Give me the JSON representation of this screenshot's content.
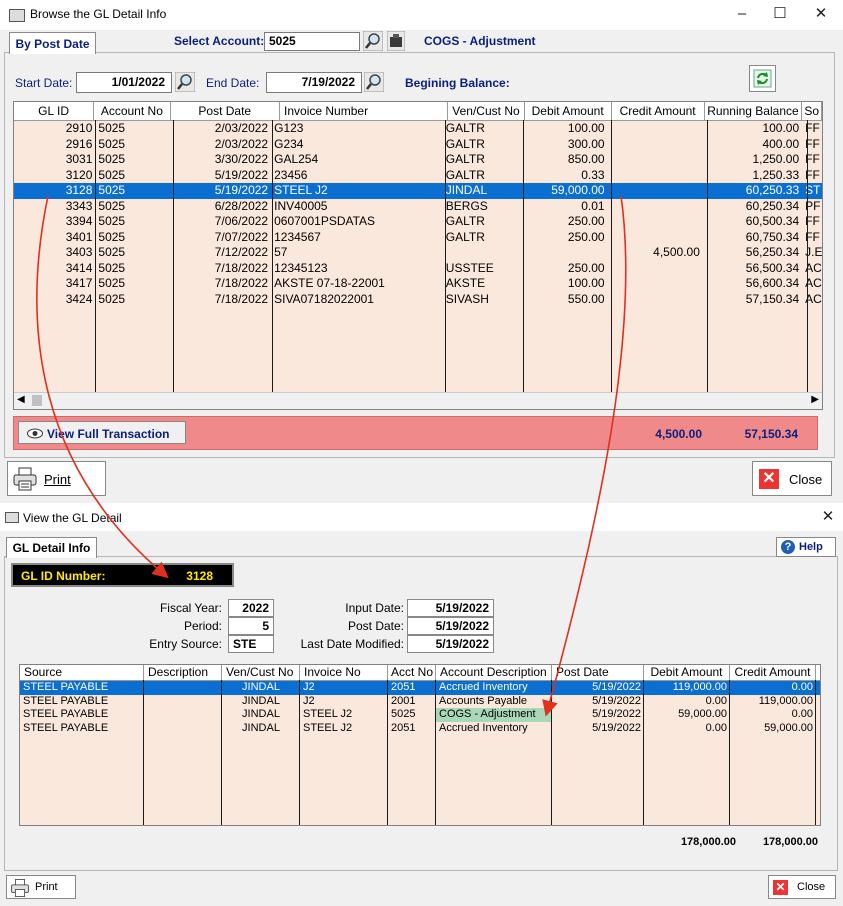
{
  "win1": {
    "title": "Browse the GL Detail Info",
    "tab": "By Post Date",
    "select_account_label": "Select Account:",
    "account_value": "5025",
    "account_name": "COGS - Adjustment",
    "start_date_label": "Start Date:",
    "start_date": "1/01/2022",
    "end_date_label": "End Date:",
    "end_date": "7/19/2022",
    "beginning_balance_label": "Begining Balance:",
    "columns": [
      "GL ID",
      "Account No",
      "Post Date",
      "Invoice Number",
      "Ven/Cust No",
      "Debit Amount",
      "Credit Amount",
      "Running Balance",
      "So"
    ],
    "rows": [
      {
        "id": "2910",
        "acct": "5025",
        "date": "2/03/2022",
        "inv": "G123",
        "ven": "GALTR",
        "debit": "100.00",
        "credit": "",
        "bal": "100.00",
        "src": "FF"
      },
      {
        "id": "2916",
        "acct": "5025",
        "date": "2/03/2022",
        "inv": "G234",
        "ven": "GALTR",
        "debit": "300.00",
        "credit": "",
        "bal": "400.00",
        "src": "FF"
      },
      {
        "id": "3031",
        "acct": "5025",
        "date": "3/30/2022",
        "inv": "GAL254",
        "ven": "GALTR",
        "debit": "850.00",
        "credit": "",
        "bal": "1,250.00",
        "src": "FF"
      },
      {
        "id": "3120",
        "acct": "5025",
        "date": "5/19/2022",
        "inv": "23456",
        "ven": "GALTR",
        "debit": "0.33",
        "credit": "",
        "bal": "1,250.33",
        "src": "FF"
      },
      {
        "id": "3128",
        "acct": "5025",
        "date": "5/19/2022",
        "inv": "STEEL J2",
        "ven": "JINDAL",
        "debit": "59,000.00",
        "credit": "",
        "bal": "60,250.33",
        "src": "ST"
      },
      {
        "id": "3343",
        "acct": "5025",
        "date": "6/28/2022",
        "inv": "INV40005",
        "ven": "BERGS",
        "debit": "0.01",
        "credit": "",
        "bal": "60,250.34",
        "src": "PF"
      },
      {
        "id": "3394",
        "acct": "5025",
        "date": "7/06/2022",
        "inv": "0607001PSDATAS",
        "ven": "GALTR",
        "debit": "250.00",
        "credit": "",
        "bal": "60,500.34",
        "src": "FF"
      },
      {
        "id": "3401",
        "acct": "5025",
        "date": "7/07/2022",
        "inv": "1234567",
        "ven": "GALTR",
        "debit": "250.00",
        "credit": "",
        "bal": "60,750.34",
        "src": "FF"
      },
      {
        "id": "3403",
        "acct": "5025",
        "date": "7/12/2022",
        "inv": "57",
        "ven": "",
        "debit": "",
        "credit": "4,500.00",
        "bal": "56,250.34",
        "src": "J.E"
      },
      {
        "id": "3414",
        "acct": "5025",
        "date": "7/18/2022",
        "inv": "12345123",
        "ven": "USSTEE",
        "debit": "250.00",
        "credit": "",
        "bal": "56,500.34",
        "src": "AC"
      },
      {
        "id": "3417",
        "acct": "5025",
        "date": "7/18/2022",
        "inv": "AKSTE 07-18-22001",
        "ven": "AKSTE",
        "debit": "100.00",
        "credit": "",
        "bal": "56,600.34",
        "src": "AC"
      },
      {
        "id": "3424",
        "acct": "5025",
        "date": "7/18/2022",
        "inv": "SIVA07182022001",
        "ven": "SIVASH",
        "debit": "550.00",
        "credit": "",
        "bal": "57,150.34",
        "src": "AC"
      }
    ],
    "view_full_label": "View Full Transaction",
    "total_credit": "4,500.00",
    "total_balance": "57,150.34",
    "print_label": "Print",
    "close_label": "Close"
  },
  "win2": {
    "title": "View the GL Detail",
    "tab": "GL Detail Info",
    "help_label": "Help",
    "gl_id_label": "GL ID Number:",
    "gl_id_value": "3128",
    "fiscal_year_label": "Fiscal Year:",
    "fiscal_year": "2022",
    "period_label": "Period:",
    "period": "5",
    "entry_source_label": "Entry Source:",
    "entry_source": "STE",
    "input_date_label": "Input Date:",
    "input_date": "5/19/2022",
    "post_date_label": "Post Date:",
    "post_date": "5/19/2022",
    "last_modified_label": "Last Date Modified:",
    "last_modified": "5/19/2022",
    "columns": [
      "Source",
      "Description",
      "Ven/Cust No",
      "Invoice No",
      "Acct No",
      "Account Description",
      "Post Date",
      "Debit Amount",
      "Credit Amount"
    ],
    "rows": [
      {
        "src": "STEEL PAYABLE",
        "desc": "",
        "ven": "JINDAL",
        "inv": "J2",
        "acct": "2051",
        "adesc": "Accrued Inventory",
        "date": "5/19/2022",
        "debit": "119,000.00",
        "credit": "0.00"
      },
      {
        "src": "STEEL PAYABLE",
        "desc": "",
        "ven": "JINDAL",
        "inv": "J2",
        "acct": "2001",
        "adesc": "Accounts Payable",
        "date": "5/19/2022",
        "debit": "0.00",
        "credit": "119,000.00"
      },
      {
        "src": "STEEL PAYABLE",
        "desc": "",
        "ven": "JINDAL",
        "inv": "STEEL J2",
        "acct": "5025",
        "adesc": "COGS - Adjustment",
        "date": "5/19/2022",
        "debit": "59,000.00",
        "credit": "0.00"
      },
      {
        "src": "STEEL PAYABLE",
        "desc": "",
        "ven": "JINDAL",
        "inv": "STEEL J2",
        "acct": "2051",
        "adesc": "Accrued Inventory",
        "date": "5/19/2022",
        "debit": "0.00",
        "credit": "59,000.00"
      }
    ],
    "total_debit": "178,000.00",
    "total_credit": "178,000.00",
    "print_label": "Print",
    "close_label": "Close"
  },
  "colors": {
    "selection": "#0a6fd0",
    "grid_bg": "#fbe8dc",
    "summary_bar": "#f08a8a",
    "annotation_arrow": "#e0301e",
    "navy_text": "#0a1f7d"
  }
}
